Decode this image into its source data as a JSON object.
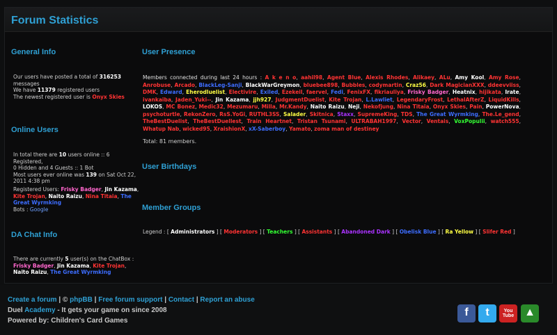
{
  "title": "Forum Statistics",
  "general": {
    "heading": "General Info",
    "line1_pre": "Our users have posted a total of ",
    "posts": "316253",
    "line1_post": " messages",
    "line2_pre": "We have ",
    "registered": "11379",
    "line2_post": " registered users",
    "newest_pre": "The newest registered user is ",
    "newest_user": "Onyx Skies"
  },
  "online": {
    "heading": "Online Users",
    "l1_pre": "In total there are ",
    "total": "10",
    "l1_post": " users online :: 6 Registered,",
    "l2": "0 Hidden and 4 Guests :: 1 Bot",
    "l3_pre": "Most users ever online was ",
    "max": "139",
    "l3_post": " on Sat Oct 22,",
    "l4": "2011 4:38 pm",
    "reg_label": "Registered Users: ",
    "users": [
      {
        "name": "Frisky Badger",
        "color": "#ff66cc"
      },
      {
        "name": "Jin Kazama",
        "color": "#ffffff"
      },
      {
        "name": "Kite Trojan",
        "color": "#ff3333"
      },
      {
        "name": "Naito Raizu",
        "color": "#ffffff"
      },
      {
        "name": "Nina Titaia",
        "color": "#ff3333"
      },
      {
        "name": "The Great Wyrmking",
        "color": "#3d6dff"
      }
    ],
    "bots_label": "Bots : ",
    "bot": "Google"
  },
  "chat": {
    "heading": "DA Chat Info",
    "l1_pre": "There are currently ",
    "count": "5",
    "l1_post": " user(s) on the ChatBox :",
    "users": [
      {
        "name": "Frisky Badger",
        "color": "#ff66cc"
      },
      {
        "name": "Jin Kazama",
        "color": "#ffffff"
      },
      {
        "name": "Kite Trojan",
        "color": "#ff3333"
      },
      {
        "name": "Naito Raizu",
        "color": "#ffffff"
      },
      {
        "name": "The Great Wyrmking",
        "color": "#3d6dff"
      }
    ]
  },
  "presence": {
    "heading": "User Presence",
    "label": "Members connected during last 24 hours : ",
    "users": [
      {
        "name": "A k e n o",
        "color": "#ff3333"
      },
      {
        "name": "aahil98",
        "color": "#ff3333"
      },
      {
        "name": "Agent Blue",
        "color": "#ff3333"
      },
      {
        "name": "Alexis Rhodes",
        "color": "#ff3333"
      },
      {
        "name": "Alikaey",
        "color": "#ff3333"
      },
      {
        "name": "ALu",
        "color": "#ff3333"
      },
      {
        "name": "Amy Kool",
        "color": "#ffffff"
      },
      {
        "name": "Amy Rose",
        "color": "#ff3333"
      },
      {
        "name": "Anrobuse",
        "color": "#ff3333"
      },
      {
        "name": "Arcado",
        "color": "#ff3333"
      },
      {
        "name": "BlackLeg-Sanji",
        "color": "#3d6dff"
      },
      {
        "name": "BlackWarGreymon",
        "color": "#ffffff"
      },
      {
        "name": "bluebee898",
        "color": "#ff3333"
      },
      {
        "name": "Bubbles",
        "color": "#ff3333"
      },
      {
        "name": "codymartin",
        "color": "#ff3333"
      },
      {
        "name": "Craz56",
        "color": "#ffff44"
      },
      {
        "name": "Dark MagicianXXX",
        "color": "#ff3333"
      },
      {
        "name": "ddeevviiss",
        "color": "#ff3333"
      },
      {
        "name": "DMK",
        "color": "#ff3333"
      },
      {
        "name": "Edward",
        "color": "#3d6dff"
      },
      {
        "name": "Eherodluelist",
        "color": "#ffff44"
      },
      {
        "name": "Electivire",
        "color": "#ff3333"
      },
      {
        "name": "Exiled",
        "color": "#3d6dff"
      },
      {
        "name": "Ezekeil",
        "color": "#ff3333"
      },
      {
        "name": "faervel",
        "color": "#ff3333"
      },
      {
        "name": "Fedi",
        "color": "#3d6dff"
      },
      {
        "name": "FenixFX",
        "color": "#ff3333"
      },
      {
        "name": "fikriauliya",
        "color": "#ff3333"
      },
      {
        "name": "Frisky Badger",
        "color": "#ff66cc"
      },
      {
        "name": "Heatnix",
        "color": "#ffffff"
      },
      {
        "name": "hijikata",
        "color": "#ff3333"
      },
      {
        "name": "Irate",
        "color": "#ffffff"
      },
      {
        "name": "ivankaiba",
        "color": "#ff3333"
      },
      {
        "name": "Jaden_Yuki--",
        "color": "#ff3333"
      },
      {
        "name": "Jin Kazama",
        "color": "#ffffff"
      },
      {
        "name": "jjh927",
        "color": "#ffff44"
      },
      {
        "name": "JudgmentDuelist",
        "color": "#ff3333"
      },
      {
        "name": "Kite Trojan",
        "color": "#ff3333"
      },
      {
        "name": "L.Lawliet",
        "color": "#3d6dff"
      },
      {
        "name": "LegendaryFrost",
        "color": "#ff3333"
      },
      {
        "name": "LethalAfterZ",
        "color": "#ff3333"
      },
      {
        "name": "LiquidKills",
        "color": "#ff3333"
      },
      {
        "name": "LOKOS",
        "color": "#ffffff"
      },
      {
        "name": "MC Bonez",
        "color": "#ff3333"
      },
      {
        "name": "Medic32",
        "color": "#ff3333"
      },
      {
        "name": "Mezumaru",
        "color": "#ff3333"
      },
      {
        "name": "Milla",
        "color": "#ff3333"
      },
      {
        "name": "Mr.Kandy",
        "color": "#ff3333"
      },
      {
        "name": "Naito Raizu",
        "color": "#ffffff"
      },
      {
        "name": "Neji",
        "color": "#ffffff"
      },
      {
        "name": "Nekofjung",
        "color": "#ff3333"
      },
      {
        "name": "Nina Titaia",
        "color": "#ff3333"
      },
      {
        "name": "Onyx Skies",
        "color": "#ff3333"
      },
      {
        "name": "Pain",
        "color": "#ff3333"
      },
      {
        "name": "PowerNova",
        "color": "#ffffff"
      },
      {
        "name": "psychoturtle",
        "color": "#ff3333"
      },
      {
        "name": "RekonZero",
        "color": "#ff3333"
      },
      {
        "name": "RsS.YoGi",
        "color": "#ff3333"
      },
      {
        "name": "RUTHL3SS",
        "color": "#ff3333"
      },
      {
        "name": "Salader",
        "color": "#ffff44"
      },
      {
        "name": "Skitnica",
        "color": "#ff3333"
      },
      {
        "name": "Staxx",
        "color": "#aa33ff"
      },
      {
        "name": "SupremeKing",
        "color": "#ff3333"
      },
      {
        "name": "TDS",
        "color": "#ff3333"
      },
      {
        "name": "The Great Wyrmking",
        "color": "#3d6dff"
      },
      {
        "name": "The.Le_gend",
        "color": "#ff3333"
      },
      {
        "name": "TheBestDuelist",
        "color": "#ff3333"
      },
      {
        "name": "TheBestDuellest",
        "color": "#ff3333"
      },
      {
        "name": "Train Heartnet",
        "color": "#ff3333"
      },
      {
        "name": "Tristan Tsunami",
        "color": "#ff3333"
      },
      {
        "name": "ULTRABAH1997",
        "color": "#ff3333"
      },
      {
        "name": "Vector",
        "color": "#ff3333"
      },
      {
        "name": "Ventais",
        "color": "#ff3333"
      },
      {
        "name": "VoxPopulii",
        "color": "#33ff33"
      },
      {
        "name": "watch555",
        "color": "#ff3333"
      },
      {
        "name": "Whatup Nab",
        "color": "#ff3333"
      },
      {
        "name": "wicked95",
        "color": "#ff3333"
      },
      {
        "name": "XraishionX",
        "color": "#ff3333"
      },
      {
        "name": "xX-Saberboy",
        "color": "#3d6dff"
      },
      {
        "name": "Yamato",
        "color": "#ff3333"
      },
      {
        "name": "zoma man of destiney",
        "color": "#ff3333"
      }
    ],
    "total": "Total: 81 members."
  },
  "birthdays": {
    "heading": "User Birthdays"
  },
  "groups": {
    "heading": "Member Groups",
    "label": "Legend : ",
    "items": [
      {
        "name": "Administrators",
        "color": "#ffffff"
      },
      {
        "name": "Moderators",
        "color": "#ff3333"
      },
      {
        "name": "Teachers",
        "color": "#33ff33"
      },
      {
        "name": "Assistants",
        "color": "#ff3333"
      },
      {
        "name": "Abandoned Dark",
        "color": "#aa33ff"
      },
      {
        "name": "Obelisk Blue",
        "color": "#3d6dff"
      },
      {
        "name": "Ra Yellow",
        "color": "#ffff44"
      },
      {
        "name": "Slifer Red",
        "color": "#ff3333"
      }
    ]
  },
  "footer": {
    "create": "Create a forum",
    "copy": "©",
    "phpbb": "phpBB",
    "free": "Free forum support",
    "contact": "Contact",
    "report": "Report an abuse",
    "duel": "Duel ",
    "academy": "Academy",
    "tagline": " - It gets your game on since 2008",
    "powered": "Powered by: Children's Card Games",
    "social": [
      {
        "label": "f",
        "icon": "facebook-icon",
        "color": "#3b5998"
      },
      {
        "label": "t",
        "icon": "twitter-icon",
        "color": "#33aaee"
      },
      {
        "label": "You Tube",
        "icon": "youtube-icon",
        "color": "#cc2222"
      },
      {
        "label": "▲",
        "icon": "game-icon",
        "color": "#2a8a2a"
      }
    ]
  }
}
